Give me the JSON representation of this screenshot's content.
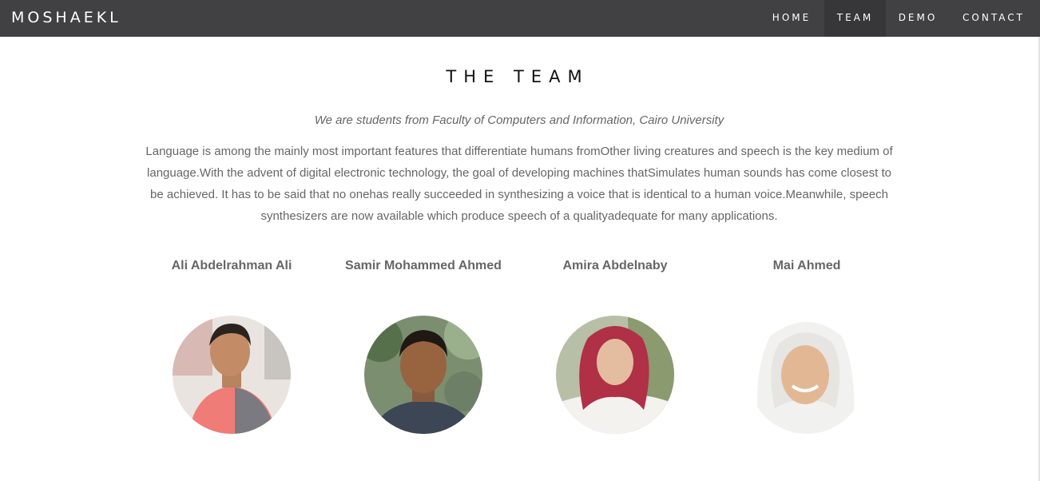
{
  "navbar": {
    "brand": "MOSHAEKL",
    "items": [
      {
        "label": "HOME",
        "active": false
      },
      {
        "label": "TEAM",
        "active": true
      },
      {
        "label": "DEMO",
        "active": false
      },
      {
        "label": "CONTACT",
        "active": false
      }
    ]
  },
  "team": {
    "title": "THE TEAM",
    "subtitle": "We are students from Faculty of Computers and Information, Cairo University",
    "description_lines": [
      "Language is among the mainly most important features that differentiate humans fromOther living creatures and speech is the key medium of",
      "language.With the advent of digital electronic technology, the goal of developing machines thatSimulates human sounds has come closest to",
      "be achieved. It has to be said that no onehas really succeeded in synthesizing a voice that is identical to a human voice.Meanwhile, speech",
      "synthesizers are now available which produce speech of a qualityadequate for many applications."
    ],
    "members": [
      {
        "name": "Ali Abdelrahman Ali"
      },
      {
        "name": "Samir Mohammed Ahmed"
      },
      {
        "name": "Amira Abdelnaby"
      },
      {
        "name": "Mai Ahmed"
      }
    ]
  },
  "colors": {
    "navbar_bg": "#414143",
    "navbar_active_bg": "#373739",
    "text_muted": "#666666"
  }
}
